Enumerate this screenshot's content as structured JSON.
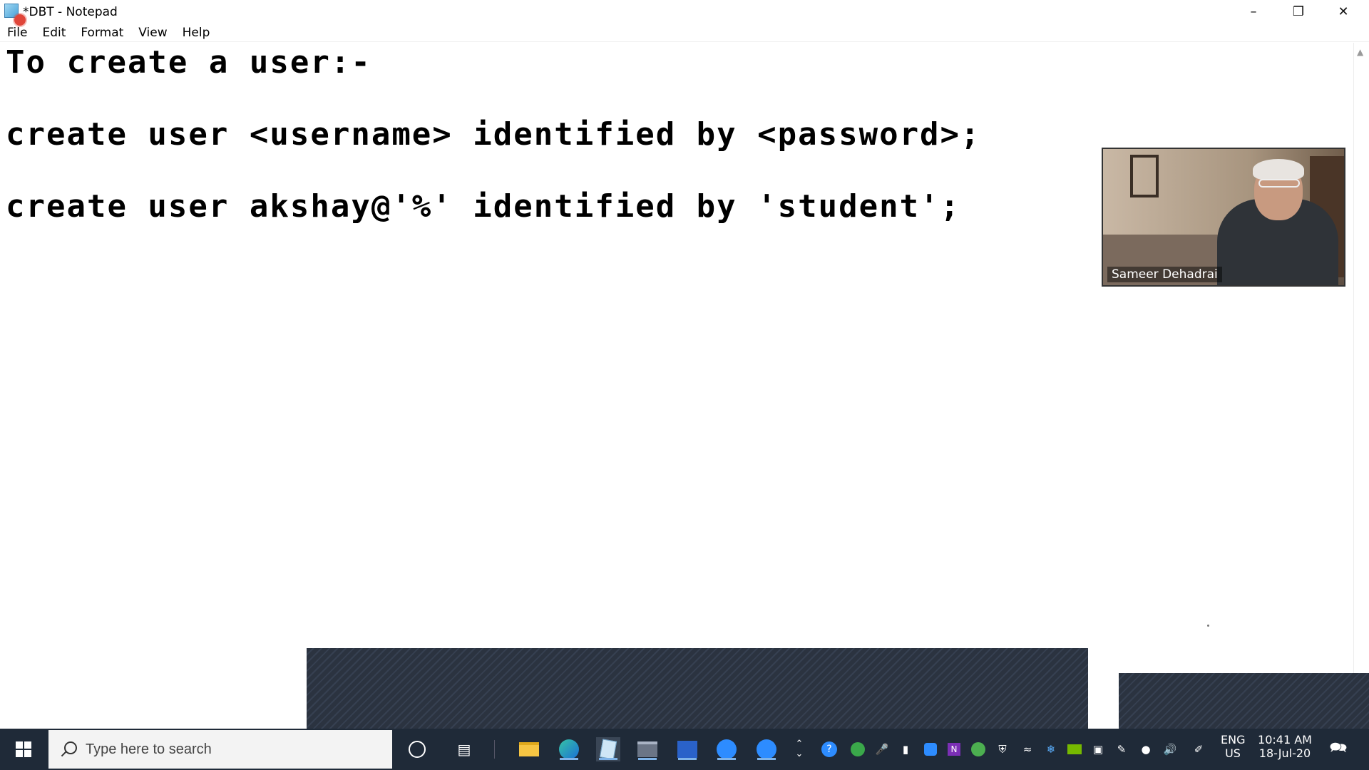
{
  "window": {
    "title": "*DBT - Notepad",
    "minimize_glyph": "–",
    "restore_glyph": "❐",
    "close_glyph": "✕"
  },
  "menu": {
    "items": [
      {
        "key": "F",
        "rest": "ile"
      },
      {
        "key": "E",
        "rest": "dit"
      },
      {
        "key": "",
        "prefix": "F",
        "key2": "o",
        "rest": "rmat"
      },
      {
        "key": "V",
        "rest": "iew"
      },
      {
        "key": "H",
        "rest": "elp"
      }
    ],
    "labels": [
      "File",
      "Edit",
      "Format",
      "View",
      "Help"
    ]
  },
  "editor": {
    "lines": [
      "To create a user:-",
      "create user <username> identified by <password>;",
      "create user akshay@'%' identified by 'student';"
    ]
  },
  "video": {
    "participant_name": "Sameer Dehadrai"
  },
  "taskbar": {
    "search_placeholder": "Type here to search",
    "language": "ENG",
    "region": "US",
    "time": "10:41 AM",
    "date": "18-Jul-20"
  },
  "colors": {
    "taskbar_bg": "#1f2a38",
    "overlay": "#2b3340",
    "record_dot": "#e0463a"
  }
}
